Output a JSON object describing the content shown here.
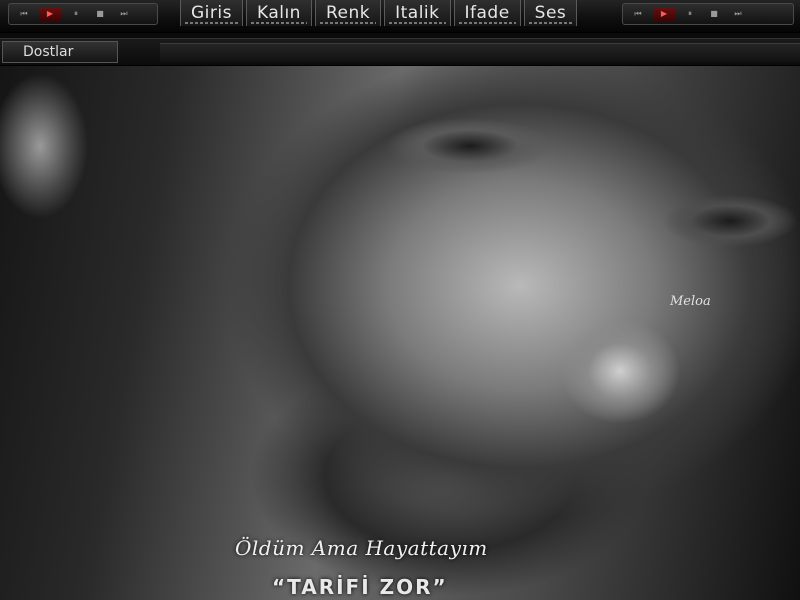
{
  "players": {
    "left": {
      "buttons": [
        {
          "icon": "skip-back-icon",
          "glyph": "⏮"
        },
        {
          "icon": "play-icon",
          "glyph": "▶"
        },
        {
          "icon": "pause-icon",
          "glyph": "⏸"
        },
        {
          "icon": "stop-icon",
          "glyph": "■"
        },
        {
          "icon": "skip-forward-icon",
          "glyph": "⏭"
        }
      ]
    },
    "right": {
      "buttons": [
        {
          "icon": "skip-back-icon",
          "glyph": "⏮"
        },
        {
          "icon": "play-icon",
          "glyph": "▶"
        },
        {
          "icon": "pause-icon",
          "glyph": "⏸"
        },
        {
          "icon": "stop-icon",
          "glyph": "■"
        },
        {
          "icon": "skip-forward-icon",
          "glyph": "⏭"
        }
      ]
    }
  },
  "menu": {
    "items": [
      {
        "label": "Giris"
      },
      {
        "label": "Kalın"
      },
      {
        "label": "Renk"
      },
      {
        "label": "Italik"
      },
      {
        "label": "Ifade"
      },
      {
        "label": "Ses"
      }
    ]
  },
  "sidebar": {
    "friends_label": "Dostlar"
  },
  "photo": {
    "signature": "Meloa",
    "quote": "Öldüm Ama Hayattayım",
    "tagline": "“TARİFİ ZOR”"
  },
  "colors": {
    "accent_play": "#ff5a5a",
    "menu_text": "#e6e6e6"
  }
}
